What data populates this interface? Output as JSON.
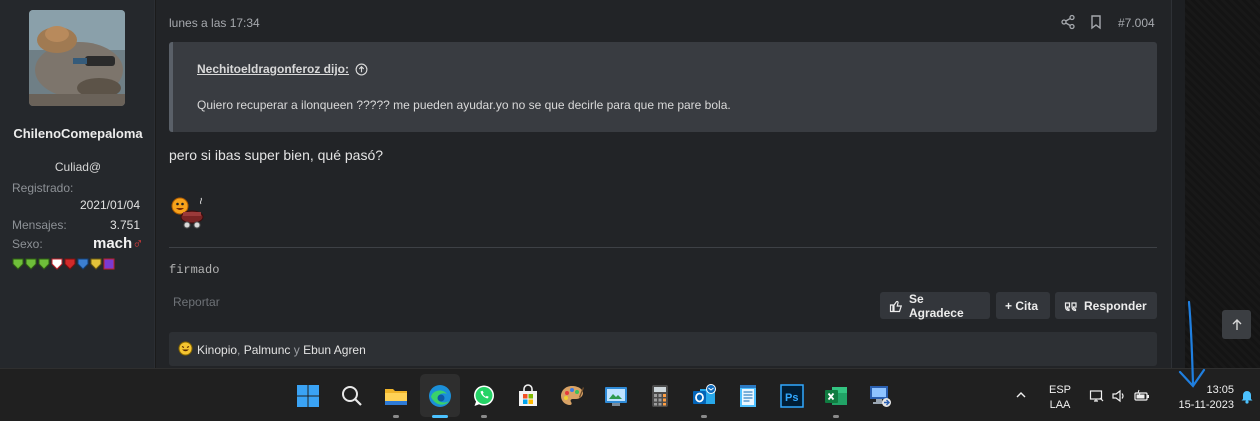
{
  "user": {
    "name": "ChilenoComepaloma",
    "title": "Culiad@",
    "registered_label": "Registrado:",
    "registered": "2021/01/04",
    "messages_label": "Mensajes:",
    "messages": "3.751",
    "sex_label": "Sexo:",
    "sex_value": "mach",
    "sex_symbol": "♂"
  },
  "post": {
    "date": "lunes a las 17:34",
    "number": "#7.004",
    "quote_author": "Nechitoeldragonferoz dijo:",
    "quote_text": "Quiero recuperar a ilonqueen ????? me pueden ayudar.yo no se que decirle para que me pare bola.",
    "message": "pero si ibas super bien, qué pasó?",
    "signature": "firmado",
    "report": "Reportar",
    "thanks_label": "Se Agradece",
    "quote_label": "+ Cita",
    "reply_label": "Responder"
  },
  "reactions": {
    "users": [
      "Kinopio",
      "Palmunc",
      "Ebun Agren"
    ],
    "sep1": ", ",
    "sep2": " y "
  },
  "taskbar": {
    "apps": [
      "windows-start",
      "search",
      "file-explorer",
      "edge",
      "whatsapp",
      "microsoft-store",
      "paint",
      "control-panel",
      "calculator",
      "outlook",
      "notepad",
      "photoshop",
      "excel",
      "remote-desktop"
    ],
    "lang_line1": "ESP",
    "lang_line2": "LAA",
    "time": "13:05",
    "date": "15-11-2023"
  },
  "colors": {
    "accent": "#4cc2ff",
    "panel": "#25282c",
    "post": "#222427",
    "quote": "#393c41"
  }
}
